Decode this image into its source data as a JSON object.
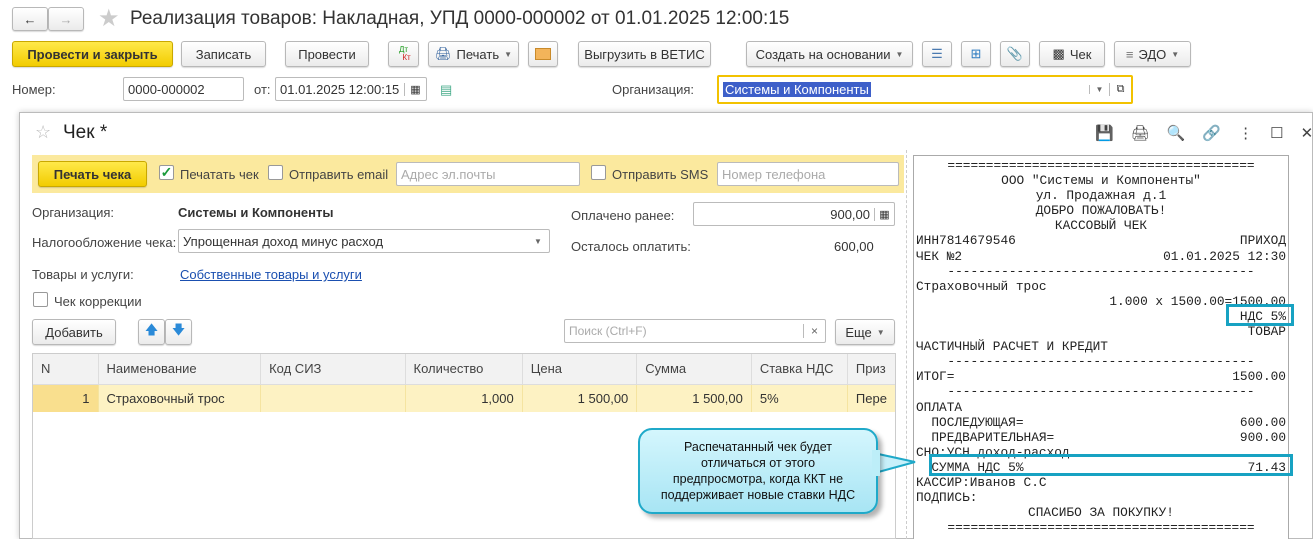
{
  "window": {
    "title": "Реализация товаров: Накладная, УПД 0000-000002 от 01.01.2025 12:00:15"
  },
  "toolbar": {
    "post_close": "Провести и закрыть",
    "save": "Записать",
    "post": "Провести",
    "dtkt_dt": "Дт",
    "dtkt_kt": "Кт",
    "print": "Печать",
    "vetis": "Выгрузить в ВЕТИС",
    "create_based": "Создать на основании",
    "check": "Чек",
    "edo": "ЭДО"
  },
  "doc": {
    "number_label": "Номер:",
    "number": "0000-000002",
    "date_label": "от:",
    "date": "01.01.2025 12:00:15",
    "org_label": "Организация:",
    "org": "Системы и Компоненты"
  },
  "dialog": {
    "title": "Чек *",
    "print_check_btn": "Печать чека",
    "print_check_label": "Печатать чек",
    "print_check_checked": true,
    "send_email_label": "Отправить email",
    "send_email_checked": false,
    "email_placeholder": "Адрес эл.почты",
    "send_sms_label": "Отправить SMS",
    "send_sms_checked": false,
    "phone_placeholder": "Номер телефона",
    "org_label": "Организация:",
    "org": "Системы и Компоненты",
    "tax_label": "Налогообложение чека:",
    "tax": "Упрощенная доход минус расход",
    "goods_label": "Товары и услуги:",
    "goods_link": "Собственные товары и услуги",
    "correction_label": "Чек коррекции",
    "correction_checked": false,
    "paid_label": "Оплачено ранее:",
    "paid": "900,00",
    "remain_label": "Осталось оплатить:",
    "remain": "600,00",
    "add_btn": "Добавить",
    "search_placeholder": "Поиск (Ctrl+F)",
    "search_clear": "×",
    "more_btn": "Еще",
    "columns": [
      "N",
      "Наименование",
      "Код СИЗ",
      "Количество",
      "Цена",
      "Сумма",
      "Ставка НДС",
      "Приз"
    ],
    "rows": [
      [
        "1",
        "Страховочный трос",
        "",
        "1,000",
        "1 500,00",
        "1 500,00",
        "5%",
        "Пере"
      ]
    ]
  },
  "receipt": {
    "lines": [
      {
        "t": "c",
        "a": "========================================"
      },
      {
        "t": "c",
        "a": "ООО \"Системы и Компоненты\""
      },
      {
        "t": "c",
        "a": "ул. Продажная д.1"
      },
      {
        "t": "c",
        "a": "ДОБРО ПОЖАЛОВАТЬ!"
      },
      {
        "t": "c",
        "a": "КАССОВЫЙ ЧЕК"
      },
      {
        "t": "lr",
        "a": "ИНН7814679546",
        "b": "ПРИХОД"
      },
      {
        "t": "lr",
        "a": "ЧЕК №2",
        "b": "01.01.2025 12:30"
      },
      {
        "t": "c",
        "a": "----------------------------------------"
      },
      {
        "t": "lr",
        "a": "Страховочный трос",
        "b": ""
      },
      {
        "t": "r",
        "a": "1.000 x 1500.00=1500.00"
      },
      {
        "t": "r",
        "a": "НДС 5%"
      },
      {
        "t": "r",
        "a": "ТОВАР"
      },
      {
        "t": "lr",
        "a": "ЧАСТИЧНЫЙ РАСЧЕТ И КРЕДИТ",
        "b": ""
      },
      {
        "t": "c",
        "a": "----------------------------------------"
      },
      {
        "t": "lr",
        "a": "ИТОГ=",
        "b": "1500.00"
      },
      {
        "t": "c",
        "a": "----------------------------------------"
      },
      {
        "t": "lr",
        "a": "ОПЛАТА",
        "b": ""
      },
      {
        "t": "lr",
        "a": "  ПОСЛЕДУЮЩАЯ=",
        "b": "600.00"
      },
      {
        "t": "lr",
        "a": "  ПРЕДВАРИТЕЛЬНАЯ=",
        "b": "900.00"
      },
      {
        "t": "lr",
        "a": "СНО:УСН доход-расход",
        "b": ""
      },
      {
        "t": "lr",
        "a": "  СУММА НДС 5%",
        "b": "71.43"
      },
      {
        "t": "lr",
        "a": "КАССИР:Иванов С.С",
        "b": ""
      },
      {
        "t": "lr",
        "a": "ПОДПИСЬ:",
        "b": ""
      },
      {
        "t": "c",
        "a": "СПАСИБО ЗА ПОКУПКУ!"
      },
      {
        "t": "c",
        "a": "========================================"
      }
    ]
  },
  "callout": {
    "text": "Распечатанный чек будет отличаться от этого предпросмотра, когда ККТ не поддерживает новые ставки НДС"
  },
  "colors": {
    "accent_yellow": "#f5d000",
    "highlight": "#17a2c2",
    "selection": "#3d5fc9"
  }
}
